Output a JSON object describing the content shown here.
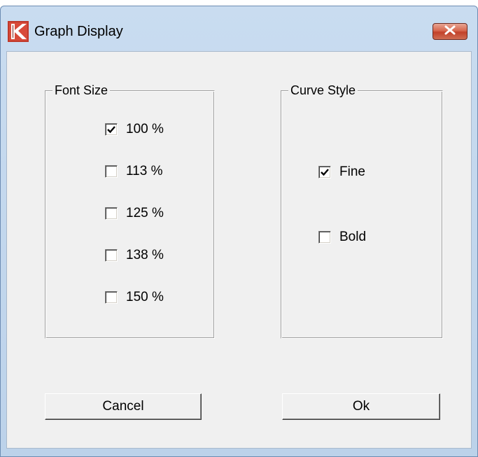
{
  "window": {
    "title": "Graph Display",
    "icon": "app-logo-icon",
    "close_icon": "close-icon",
    "accent_color": "#c0392b"
  },
  "font_size_group": {
    "label": "Font Size",
    "options": [
      {
        "label": "100 %",
        "checked": true
      },
      {
        "label": "113 %",
        "checked": false
      },
      {
        "label": "125 %",
        "checked": false
      },
      {
        "label": "138 %",
        "checked": false
      },
      {
        "label": "150 %",
        "checked": false
      }
    ]
  },
  "curve_style_group": {
    "label": "Curve Style",
    "options": [
      {
        "label": "Fine",
        "checked": true
      },
      {
        "label": "Bold",
        "checked": false
      }
    ]
  },
  "buttons": {
    "cancel_label": "Cancel",
    "ok_label": "Ok"
  }
}
